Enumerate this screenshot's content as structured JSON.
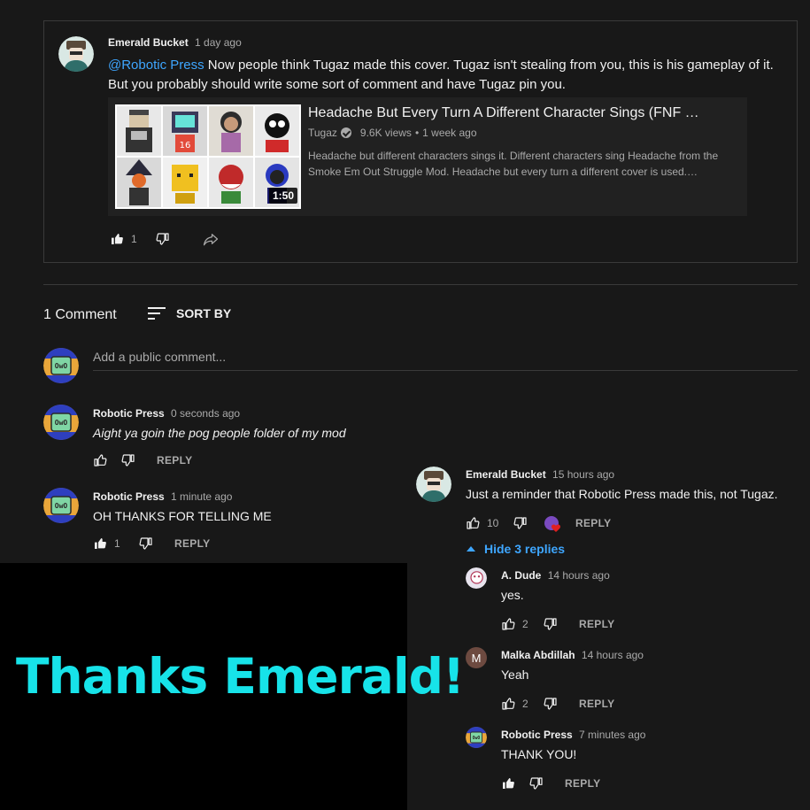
{
  "card": {
    "author": "Emerald Bucket",
    "time": "1 day ago",
    "mention": "@Robotic Press",
    "text": " Now people think Tugaz made this cover. Tugaz isn't stealing from you, this is his gameplay of it. But you probably should write some sort of comment and have Tugaz pin you.",
    "video": {
      "title": "Headache But Every Turn A Different Character Sings (FNF …",
      "channel": "Tugaz",
      "views": "9.6K views",
      "age": "1 week ago",
      "description": "Headache but different characters sings it. Different characters sing Headache from the Smoke Em Out Struggle Mod. Headache but every turn a different cover is used.…",
      "duration": "1:50"
    },
    "likes": "1"
  },
  "comments_header": {
    "count_label": "1 Comment",
    "sort_label": "SORT BY"
  },
  "add_comment": {
    "placeholder": "Add a public comment..."
  },
  "comments": [
    {
      "author": "Robotic Press",
      "time": "0 seconds ago",
      "text": "Aight ya goin the pog people folder of my mod",
      "likes": "",
      "reply": "REPLY"
    },
    {
      "author": "Robotic Press",
      "time": "1 minute ago",
      "text": "OH THANKS FOR TELLING ME",
      "likes": "1",
      "reply": "REPLY"
    }
  ],
  "thread": {
    "author": "Emerald Bucket",
    "time": "15 hours ago",
    "text": "Just a reminder that Robotic Press made this, not Tugaz.",
    "likes": "10",
    "reply": "REPLY",
    "hide_replies": "Hide 3 replies",
    "replies": [
      {
        "author": "A. Dude",
        "time": "14 hours ago",
        "text": "yes.",
        "likes": "2",
        "reply": "REPLY"
      },
      {
        "author": "Malka Abdillah",
        "time": "14 hours ago",
        "text": "Yeah",
        "likes": "2",
        "reply": "REPLY",
        "avatar_letter": "M"
      },
      {
        "author": "Robotic Press",
        "time": "7 minutes ago",
        "text": "THANK YOU!",
        "likes": "",
        "reply": "REPLY"
      }
    ]
  },
  "overlay_text": "Thanks Emerald!",
  "colors": {
    "link": "#3ea6ff",
    "overlay": "#17e3e9",
    "background": "#181818"
  }
}
